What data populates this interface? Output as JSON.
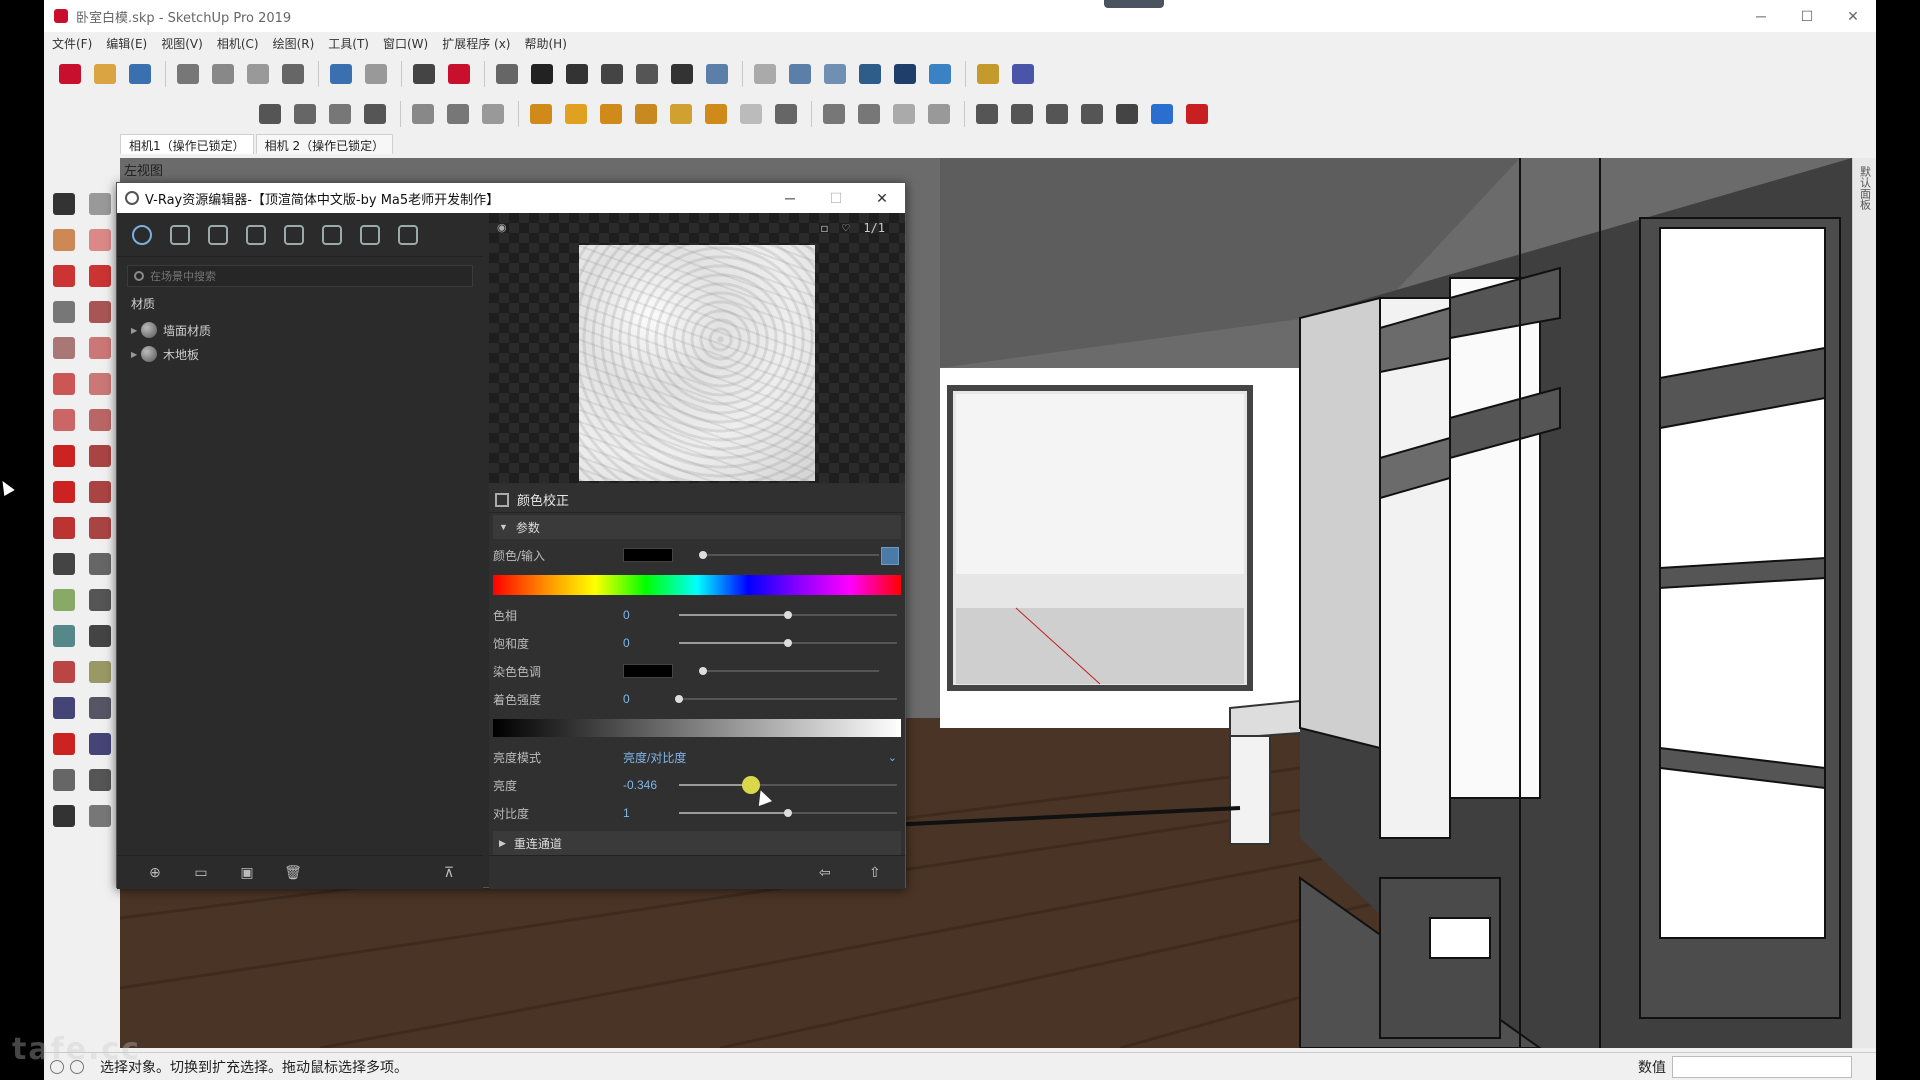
{
  "window": {
    "title": "卧室白模.skp - SketchUp Pro 2019",
    "controls": [
      "─",
      "☐",
      "✕"
    ]
  },
  "menu": [
    "文件(F)",
    "编辑(E)",
    "视图(V)",
    "相机(C)",
    "绘图(R)",
    "工具(T)",
    "窗口(W)",
    "扩展程序 (x)",
    "帮助(H)"
  ],
  "scene_tabs": [
    "相机1（操作已锁定）",
    "相机 2（操作已锁定）"
  ],
  "viewport": {
    "label": "左视图"
  },
  "tray": {
    "label": "默认面板"
  },
  "status": {
    "hint": "选择对象。切换到扩充选择。拖动鼠标选择多项。",
    "measure_label": "数值",
    "measure_value": ""
  },
  "vray": {
    "title": "V-Ray资源编辑器-【顶渲简体中文版-by Ma5老师开发制作】",
    "controls": [
      "─",
      "☐",
      "✕"
    ],
    "search_placeholder": "在场景中搜索",
    "category": "材质",
    "materials": [
      "墙面材质",
      "木地板"
    ],
    "preview_tools": [
      "◻",
      "♡",
      "1/1"
    ],
    "panel_title": "颜色校正",
    "section": "参数",
    "params": {
      "color_input_label": "颜色/输入",
      "hue_label": "色相",
      "hue_value": "0",
      "saturation_label": "饱和度",
      "saturation_value": "0",
      "tint_color_label": "染色色调",
      "tint_strength_label": "着色强度",
      "tint_strength_value": "0",
      "brightness_mode_label": "亮度模式",
      "brightness_mode_value": "亮度/对比度",
      "brightness_label": "亮度",
      "brightness_value": "-0.346",
      "contrast_label": "对比度",
      "contrast_value": "1"
    },
    "remap_section": "重连通道",
    "slider_levels": {
      "hue": 0.5,
      "saturation": 0.5,
      "tint_strength": 0.0,
      "brightness": 0.33,
      "contrast": 0.5
    }
  },
  "watermark": "tafe.cc",
  "colors": {
    "vray_bg": "#2b2b2b",
    "vray_accent": "#7fb6ea",
    "active_knob": "#d8d84a",
    "sketchup_red": "#c8102e"
  },
  "icons": {
    "toolbar1": [
      "new-icon",
      "open-icon",
      "save-icon",
      "cut-icon",
      "copy-icon",
      "paste-icon",
      "erase-icon",
      "undo-icon",
      "redo-icon",
      "print-icon",
      "model-info-icon",
      "iso-view-icon",
      "top-view-icon",
      "front-view-icon",
      "right-view-icon",
      "back-view-icon",
      "left-view-icon",
      "xray-icon",
      "backedges-icon",
      "wireframe-icon",
      "hiddenline-icon",
      "shaded-icon",
      "textured-icon",
      "monochrome-icon",
      "section-icon",
      "style-icon"
    ],
    "toolbar2": [
      "vray-render-icon",
      "vray-teapot-icon",
      "vray-interactive-icon",
      "vray-viewer-icon",
      "vray-frame-icon",
      "vray-batch-icon",
      "vray-lock-icon",
      "vray-rect-light-icon",
      "vray-sphere-light-icon",
      "vray-spot-light-icon",
      "vray-ies-light-icon",
      "vray-omni-light-icon",
      "vray-dome-light-icon",
      "vray-mesh-light-icon",
      "vray-infinite-plane-icon",
      "vray-proxy-icon",
      "vray-export-proxy-icon",
      "vray-fur-icon",
      "vray-clipper-icon",
      "vray-camera-icon",
      "vray-rtt-icon",
      "vray-denoise-icon",
      "vray-lightgen-icon",
      "vray-pack-icon",
      "vray-cloud-icon",
      "vray-close-icon"
    ],
    "palette": [
      "select-icon",
      "component-icon",
      "paint-bucket-icon",
      "eraser-icon",
      "line-icon",
      "freehand-icon",
      "rectangle-icon",
      "rotated-rect-icon",
      "circle-icon",
      "polygon-icon",
      "arc-icon",
      "pie-icon",
      "two-point-arc-icon",
      "three-point-arc-icon",
      "move-icon",
      "push-pull-icon",
      "rotate-icon",
      "follow-me-icon",
      "scale-icon",
      "offset-icon",
      "tape-icon",
      "dimension-icon",
      "protractor-icon",
      "text-icon",
      "axes-icon",
      "3d-text-icon",
      "orbit-icon",
      "pan-icon",
      "zoom-icon",
      "zoom-window-icon",
      "zoom-extents-icon",
      "previous-icon",
      "position-camera-icon",
      "look-around-icon",
      "walk-icon",
      "section-plane-icon"
    ]
  }
}
